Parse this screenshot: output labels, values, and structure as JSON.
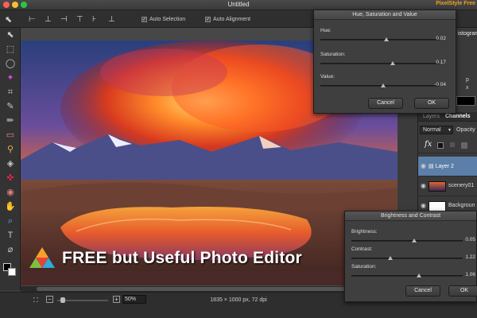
{
  "window": {
    "title": "Untitled",
    "brand": "PixelStyle Free"
  },
  "toolbar": {
    "auto_selection": "Auto Selection",
    "auto_alignment": "Auto Alignment"
  },
  "canvas": {
    "watermark_text": "FREE but Useful Photo Editor"
  },
  "status": {
    "dimensions": "1835 × 1000 px, 72 dpi",
    "zoom": "50%"
  },
  "hue_dialog": {
    "title": "Hue, Saturation and Value",
    "hue_label": "Hue:",
    "hue_value": "0.02",
    "saturation_label": "Saturation:",
    "saturation_value": "0.17",
    "value_label": "Value:",
    "value_value": "-0.04",
    "cancel": "Cancel",
    "ok": "OK"
  },
  "bc_dialog": {
    "title": "Brightness and Contrast",
    "brightness_label": "Brightness:",
    "brightness_value": "0.05",
    "contrast_label": "Contrast:",
    "contrast_value": "1.22",
    "saturation_label": "Saturation:",
    "saturation_value": "1.06",
    "cancel": "Cancel",
    "ok": "OK"
  },
  "right_panel": {
    "histogram_tab": "istogram",
    "r_value": "p",
    "x_value": "x",
    "layers_tab": "Layers",
    "channels_tab": "Channels",
    "blend_mode": "Normal",
    "opacity_label": "Opacity",
    "fx_label": "fx",
    "layers": [
      "Layer 2",
      "scenery01",
      "Backgroun"
    ]
  }
}
